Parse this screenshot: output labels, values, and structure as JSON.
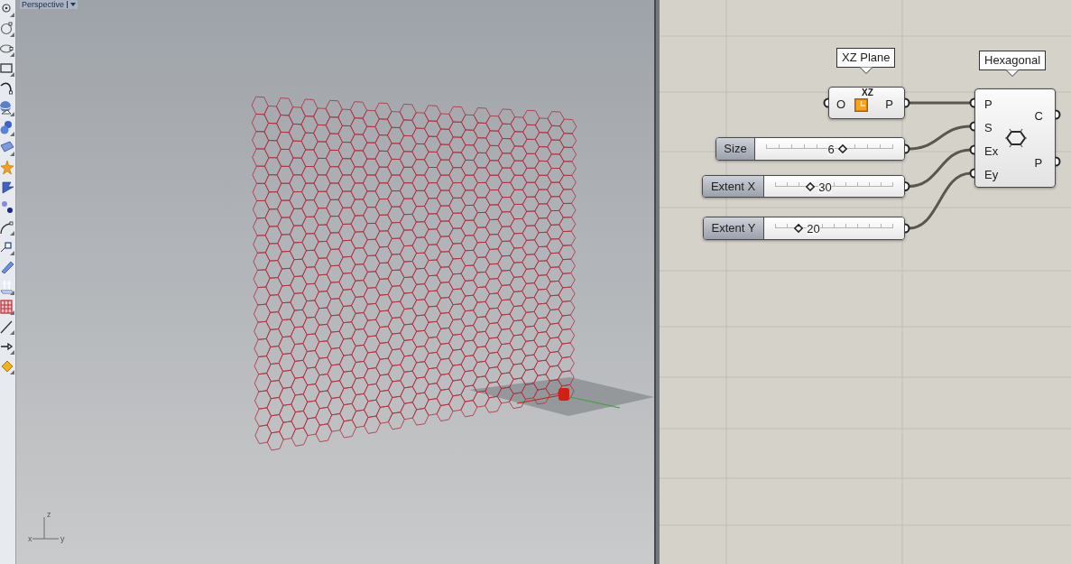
{
  "viewport": {
    "title": "Perspective",
    "axes": [
      {
        "label": "z"
      },
      {
        "label": "x"
      },
      {
        "label": "y"
      }
    ]
  },
  "canvas": {
    "components": [
      {
        "kind": "plane",
        "label": "XZ Plane",
        "caption": "XZ",
        "inputs": [
          "O"
        ],
        "outputs": [
          "P"
        ]
      },
      {
        "kind": "hexagonal",
        "label": "Hexagonal",
        "inputs": [
          "P",
          "S",
          "Ex",
          "Ey"
        ],
        "outputs": [
          "C",
          "P"
        ]
      }
    ],
    "sliders": [
      {
        "name": "Size",
        "value": "6",
        "level": 0.6
      },
      {
        "name": "Extent X",
        "value": "30",
        "level": 0.3
      },
      {
        "name": "Extent Y",
        "value": "20",
        "level": 0.2
      }
    ]
  }
}
